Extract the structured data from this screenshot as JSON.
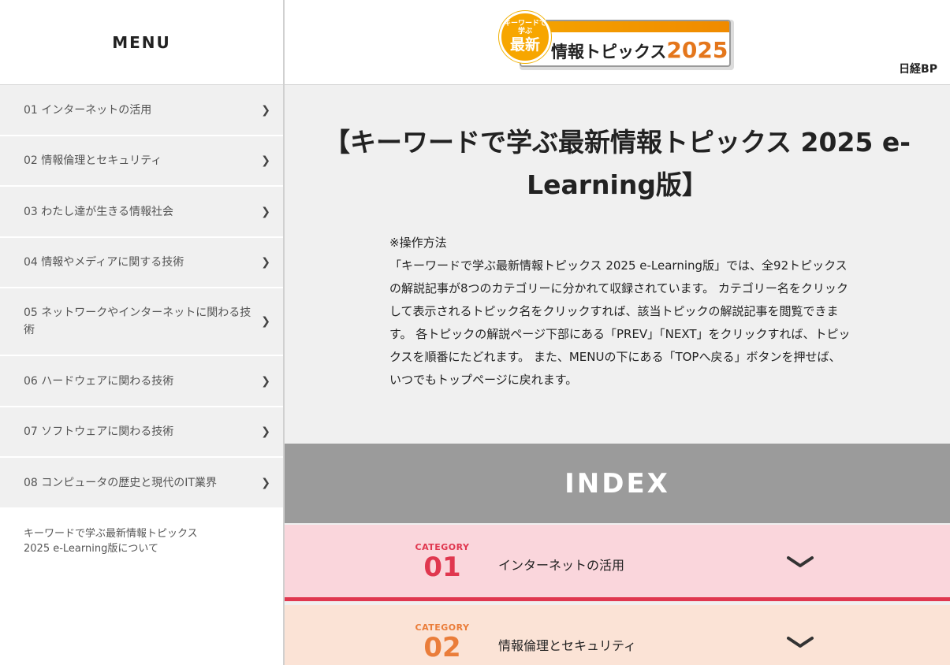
{
  "sidebar": {
    "menu_title": "MENU",
    "items": [
      {
        "label": "01 インターネットの活用"
      },
      {
        "label": "02 情報倫理とセキュリティ"
      },
      {
        "label": "03 わたし達が生きる情報社会"
      },
      {
        "label": "04 情報やメディアに関する技術"
      },
      {
        "label": "05 ネットワークやインターネットに関わる技術"
      },
      {
        "label": "06 ハードウェアに関わる技術"
      },
      {
        "label": "07 ソフトウェアに関わる技術"
      },
      {
        "label": "08 コンピュータの歴史と現代のIT業界"
      }
    ],
    "chevron": "❯",
    "about_line1": "キーワードで学ぶ最新情報トピックス",
    "about_line2": "2025 e-Learning版について"
  },
  "header": {
    "logo": {
      "circle_small": "キーワードで学ぶ",
      "circle_big": "最新",
      "main_text": "情報トピックス",
      "year": "2025"
    },
    "publisher": "日経BP"
  },
  "main": {
    "title": "【キーワードで学ぶ最新情報トピックス 2025 e-Learning版】",
    "howto_heading": "※操作方法",
    "howto_body": "「キーワードで学ぶ最新情報トピックス 2025 e-Learning版」では、全92トピックスの解説記事が8つのカテゴリーに分かれて収録されています。 カテゴリー名をクリックして表示されるトピック名をクリックすれば、該当トピックの解説記事を閲覧できます。 各トピックの解説ページ下部にある「PREV」「NEXT」をクリックすれば、トピックスを順番にたどれます。 また、MENUの下にある「TOPへ戻る」ボタンを押せば、いつでもトップページに戻れます。",
    "index_label": "INDEX",
    "categories": [
      {
        "label": "CATEGORY",
        "number": "01",
        "name": "インターネットの活用",
        "color": "#e0374f"
      },
      {
        "label": "CATEGORY",
        "number": "02",
        "name": "情報倫理とセキュリティ",
        "color": "#ea7d3a"
      }
    ]
  }
}
